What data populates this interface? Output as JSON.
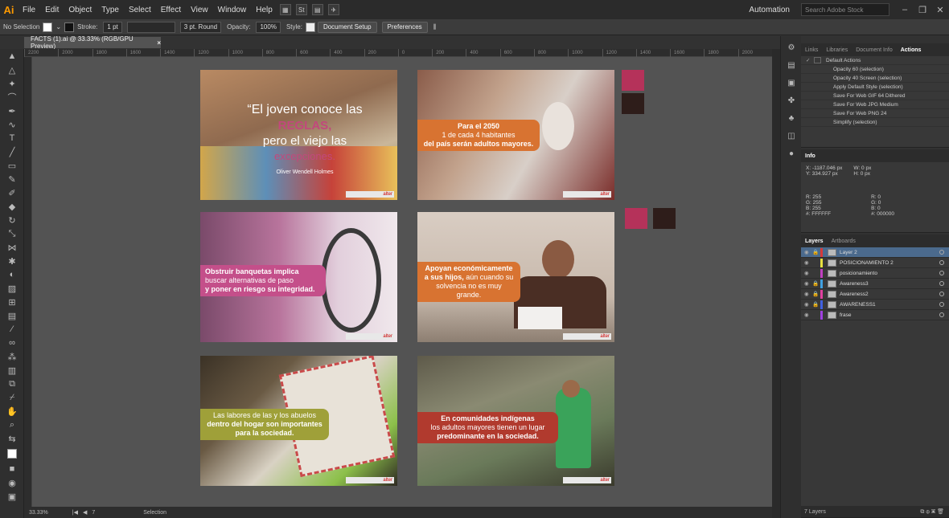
{
  "menubar": {
    "logo": "Ai",
    "items": [
      "File",
      "Edit",
      "Object",
      "Type",
      "Select",
      "Effect",
      "View",
      "Window",
      "Help"
    ],
    "workspace": "Automation",
    "search_placeholder": "Search Adobe Stock"
  },
  "controlbar": {
    "selection": "No Selection",
    "stroke_label": "Stroke:",
    "stroke_value": "1 pt",
    "brush": "3 pt. Round",
    "opacity_label": "Opacity:",
    "opacity_value": "100%",
    "style_label": "Style:",
    "document_setup": "Document Setup",
    "preferences": "Preferences"
  },
  "document": {
    "tab": "FACTS (1).ai @ 33.33% (RGB/GPU Preview)",
    "close": "×"
  },
  "ruler": [
    "2200",
    "2000",
    "1800",
    "1600",
    "1400",
    "1200",
    "1000",
    "800",
    "600",
    "400",
    "200",
    "0",
    "200",
    "400",
    "600",
    "800",
    "1000",
    "1200",
    "1400",
    "1600",
    "1800",
    "2000"
  ],
  "artboards": [
    {
      "quote_open": "“El joven conoce las",
      "quote_highlight": "REGLAS,",
      "quote_line3": "pero el viejo las",
      "quote_line4": "excepciones.",
      "author": "Oliver Wendell Holmes"
    },
    {
      "line1": "Para el 2050",
      "line2": "1 de cada 4 habitantes",
      "line3": "del país serán adultos mayores."
    },
    {
      "line1": "Obstruir banquetas implica",
      "line2": "buscar alternativas de paso",
      "line3": "y poner en riesgo su integridad."
    },
    {
      "line1": "Apoyan económicamente",
      "line2_bold": "a sus hijos,",
      "line2_rest": " aún cuando su",
      "line3": "solvencia no es muy",
      "line4": "grande."
    },
    {
      "line1": "Las labores de las y los abuelos",
      "line2": "dentro del hogar son importantes",
      "line3": "para la sociedad."
    },
    {
      "line1": "En comunidades indígenas",
      "line2": "los adultos mayores tienen un lugar",
      "line3": "predominante en la sociedad."
    }
  ],
  "logo_strip": "alter",
  "statusbar": {
    "zoom": "33.33%",
    "page": "7",
    "tool": "Selection"
  },
  "panels": {
    "actions_tabs": [
      "Links",
      "Libraries",
      "Document Info",
      "Actions"
    ],
    "actions": [
      "Default Actions",
      "Opacity 60 (selection)",
      "Opacity 40 Screen (selection)",
      "Apply Default Style (selection)",
      "Save For Web GIF 64 Dithered",
      "Save For Web JPG Medium",
      "Save For Web PNG 24",
      "Simplify (selection)"
    ],
    "info_title": "Info",
    "info": {
      "x": "X: -1187.046 px",
      "y": "Y: 334.927 px",
      "w": "W: 0 px",
      "h": "H: 0 px",
      "r1": "R: 255",
      "g1": "G: 255",
      "b1": "B: 255",
      "hex1": "#: FFFFFF",
      "r2": "R: 0",
      "g2": "G: 0",
      "b2": "B: 0",
      "hex2": "#: 000000"
    },
    "layers_tabs": [
      "Layers",
      "Artboards"
    ],
    "layers": [
      {
        "name": "Layer 2",
        "color": "#d63a3a"
      },
      {
        "name": "POSICIONAMIENTO 2",
        "color": "#e8e040"
      },
      {
        "name": "posicionamiento",
        "color": "#c040c0"
      },
      {
        "name": "Awareness3",
        "color": "#40a0e0"
      },
      {
        "name": "Awareness2",
        "color": "#e040a0"
      },
      {
        "name": "AWARENESS1",
        "color": "#4060e0"
      },
      {
        "name": "frase",
        "color": "#a040e0"
      }
    ],
    "layers_count": "7 Layers"
  },
  "colors": {
    "magenta": "#b5325a",
    "dark": "#2e1d1a",
    "orange": "#d87331",
    "pink": "#c44f8a",
    "olive": "#9fa039",
    "red": "#b13a2e"
  }
}
